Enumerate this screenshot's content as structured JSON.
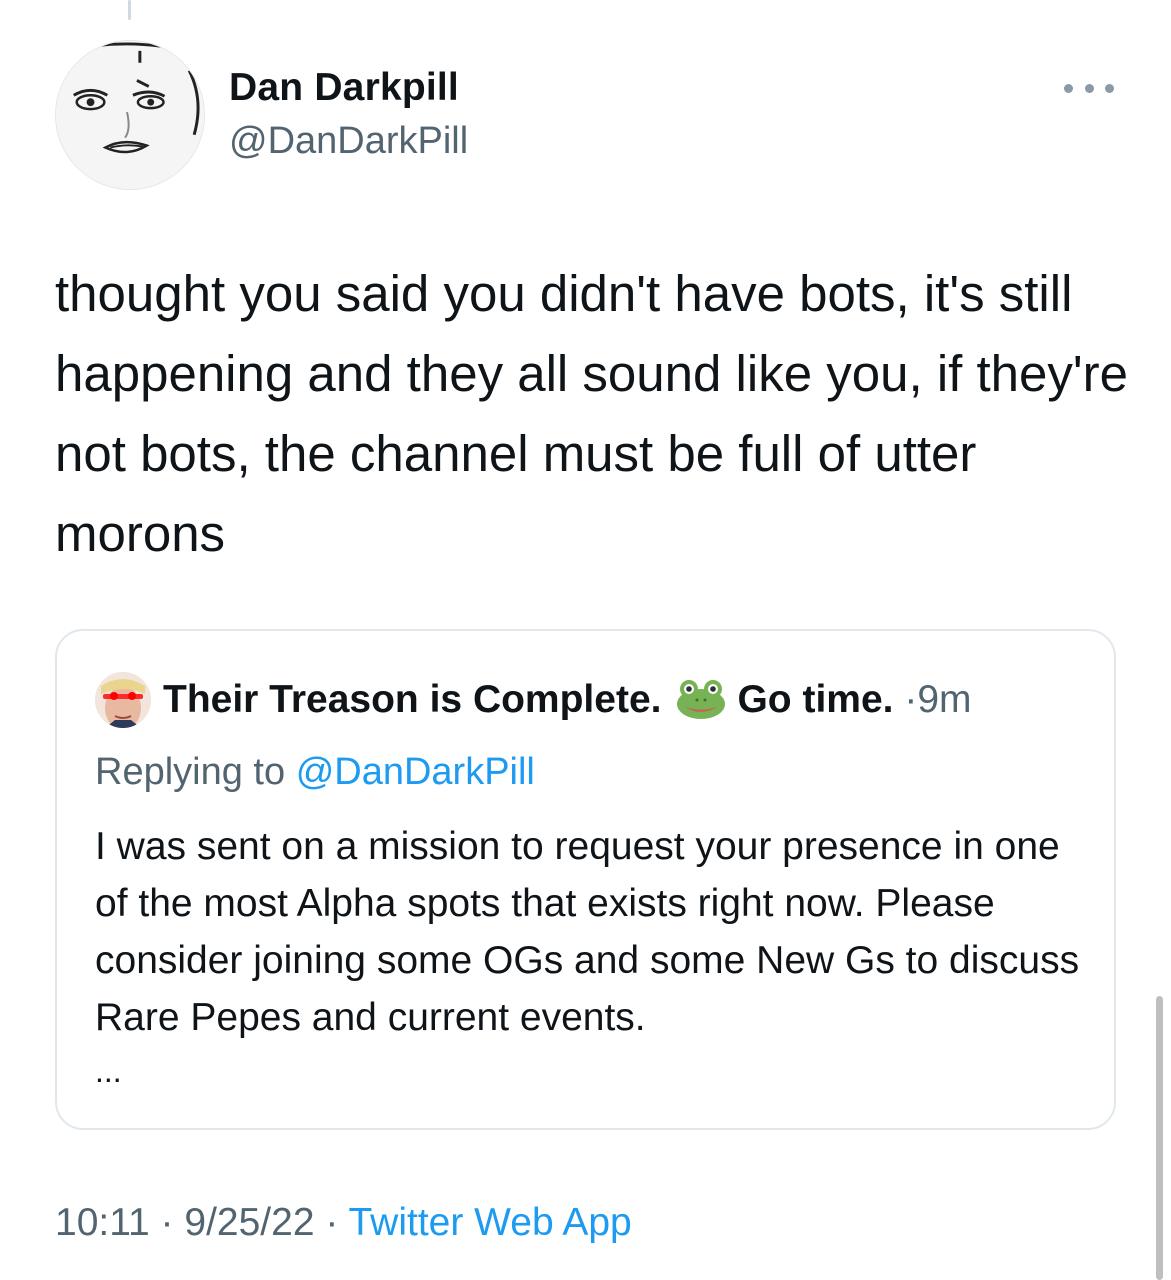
{
  "tweet": {
    "author": {
      "display_name": "Dan Darkpill",
      "handle": "@DanDarkPill",
      "avatar": "sketch-face-avatar"
    },
    "more_icon": "ellipsis-icon",
    "text": "thought you said you didn't have bots, it's still happening and they all sound like you, if they're not bots, the channel must be full of utter morons",
    "quoted": {
      "avatar": "red-eyes-face-avatar",
      "name_part1": "Their Treason is Complete.",
      "emoji": "frog-icon",
      "name_part2": "Go time.",
      "separator": "·",
      "time": "9m",
      "replying_label": "Replying to",
      "replying_to": "@DanDarkPill",
      "text": "I was sent on a mission to request your presence in one of the most Alpha spots that exists right now. Please consider joining some OGs and some New Gs to discuss Rare Pepes and current events.",
      "ellipsis": "..."
    },
    "meta": {
      "time": "10:11",
      "date": "9/25/22",
      "separator": "·",
      "source": "Twitter Web App"
    }
  },
  "colors": {
    "text": "#0f1419",
    "secondary": "#536471",
    "accent": "#1d9bf0",
    "border": "#e1e8ed"
  }
}
